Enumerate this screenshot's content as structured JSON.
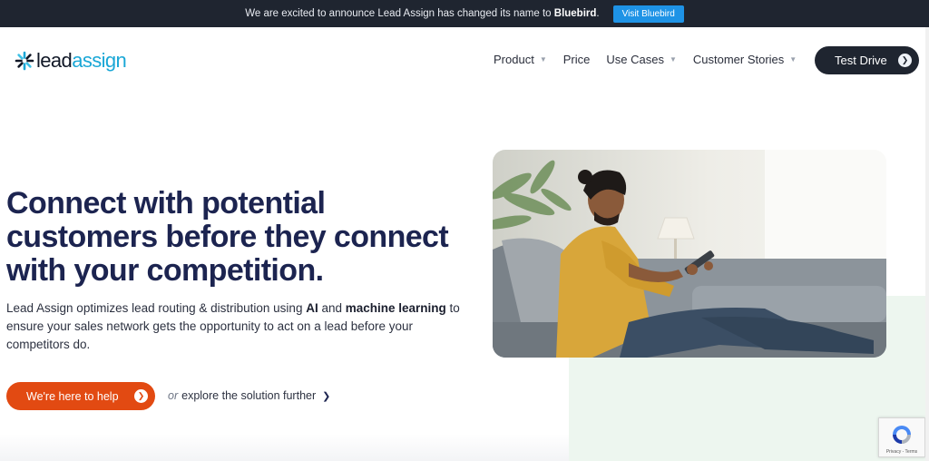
{
  "announcement": {
    "prefix": "We are excited to announce Lead Assign has changed its name to",
    "brand": "Bluebird",
    "suffix": ".",
    "button_label": "Visit Bluebird"
  },
  "logo": {
    "part1": "lead",
    "part2": "assign"
  },
  "nav": {
    "product": "Product",
    "price": "Price",
    "use_cases": "Use Cases",
    "customer_stories": "Customer Stories",
    "cta_label": "Test Drive"
  },
  "hero": {
    "title": "Connect with potential customers before they connect with your competition.",
    "desc_1": "Lead Assign optimizes lead routing & distribution using ",
    "desc_ai": "AI",
    "desc_and": " and ",
    "desc_ml": "machine learning",
    "desc_2": " to ensure your sales network gets the opportunity to act on a lead before your competitors do.",
    "cta_label": "We're here to help",
    "explore_or": "or",
    "explore_label": "explore the solution further"
  },
  "recaptcha": {
    "text": "Privacy - Terms"
  },
  "colors": {
    "dark": "#1f2530",
    "accent_blue": "#1e93e6",
    "cta_orange": "#e24a12",
    "title_navy": "#1c2450",
    "mint": "#edf6ef"
  },
  "icons": {
    "logo_mark": "asterisk-logo-icon",
    "nav_chevron": "chevron-down-icon",
    "cta_arrow": "arrow-right-circle-icon",
    "explore_arrow": "chevron-right-icon",
    "recaptcha": "recaptcha-icon"
  }
}
